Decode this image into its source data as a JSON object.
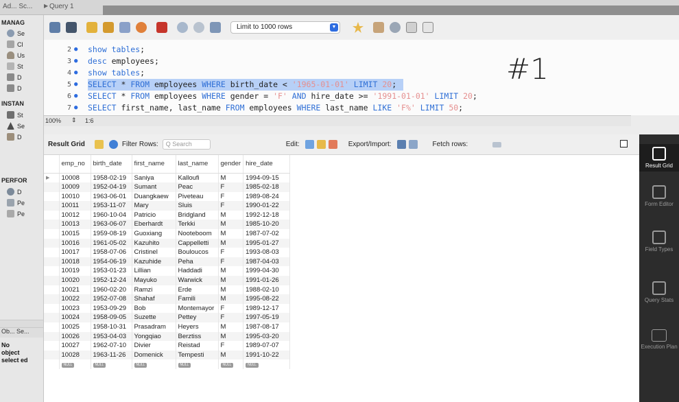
{
  "top_tabs": [
    "Ad... Sc...",
    "Query 1"
  ],
  "navigator": {
    "management_header": "MANAG",
    "management_items": [
      "Se",
      "Cl",
      "Us",
      "St",
      "D",
      "D"
    ],
    "instance_header": "INSTAN",
    "instance_items": [
      "St",
      "Se",
      "D"
    ],
    "performance_header": "PERFOR",
    "performance_items": [
      "D",
      "Pe",
      "Pe"
    ],
    "object_info_tab": "Ob... Se...",
    "no_object": "No object select ed"
  },
  "toolbar": {
    "limit_select": "Limit to 1000 rows"
  },
  "editor": {
    "annotation": "#1",
    "lines": [
      {
        "num": "2",
        "tokens": [
          {
            "t": "show tables",
            "c": "kw"
          },
          {
            "t": ";",
            "c": ""
          }
        ]
      },
      {
        "num": "3",
        "tokens": [
          {
            "t": "desc",
            "c": "kw"
          },
          {
            "t": " employees;",
            "c": ""
          }
        ]
      },
      {
        "num": "4",
        "tokens": [
          {
            "t": "show tables",
            "c": "kw"
          },
          {
            "t": ";",
            "c": ""
          }
        ]
      },
      {
        "num": "5",
        "highlight": true,
        "tokens": [
          {
            "t": "SELECT",
            "c": "kw"
          },
          {
            "t": " * ",
            "c": ""
          },
          {
            "t": "FROM",
            "c": "kw"
          },
          {
            "t": " employees ",
            "c": ""
          },
          {
            "t": "WHERE",
            "c": "kw"
          },
          {
            "t": " birth_date < ",
            "c": ""
          },
          {
            "t": "'1965-01-01'",
            "c": "str"
          },
          {
            "t": " ",
            "c": ""
          },
          {
            "t": "LIMIT",
            "c": "kw"
          },
          {
            "t": " ",
            "c": ""
          },
          {
            "t": "20",
            "c": "num2"
          },
          {
            "t": ";",
            "c": ""
          }
        ]
      },
      {
        "num": "6",
        "tokens": [
          {
            "t": "SELECT",
            "c": "kw"
          },
          {
            "t": " * ",
            "c": ""
          },
          {
            "t": "FROM",
            "c": "kw"
          },
          {
            "t": " employees ",
            "c": ""
          },
          {
            "t": "WHERE",
            "c": "kw"
          },
          {
            "t": " gender = ",
            "c": ""
          },
          {
            "t": "'F'",
            "c": "str"
          },
          {
            "t": " ",
            "c": ""
          },
          {
            "t": "AND",
            "c": "kw"
          },
          {
            "t": " hire_date >= ",
            "c": ""
          },
          {
            "t": "'1991-01-01'",
            "c": "str"
          },
          {
            "t": " ",
            "c": ""
          },
          {
            "t": "LIMIT",
            "c": "kw"
          },
          {
            "t": " ",
            "c": ""
          },
          {
            "t": "20",
            "c": "num2"
          },
          {
            "t": ";",
            "c": ""
          }
        ]
      },
      {
        "num": "7",
        "tokens": [
          {
            "t": "SELECT",
            "c": "kw"
          },
          {
            "t": " first_name, last_name ",
            "c": ""
          },
          {
            "t": "FROM",
            "c": "kw"
          },
          {
            "t": " employees ",
            "c": ""
          },
          {
            "t": "WHERE",
            "c": "kw"
          },
          {
            "t": " last_name ",
            "c": ""
          },
          {
            "t": "LIKE",
            "c": "kw"
          },
          {
            "t": " ",
            "c": ""
          },
          {
            "t": "'F%'",
            "c": "str"
          },
          {
            "t": " ",
            "c": ""
          },
          {
            "t": "LIMIT",
            "c": "kw"
          },
          {
            "t": " ",
            "c": ""
          },
          {
            "t": "50",
            "c": "num2"
          },
          {
            "t": ";",
            "c": ""
          }
        ]
      }
    ],
    "status_zoom": "100%",
    "status_position": "1:6"
  },
  "result": {
    "result_grid_label": "Result Grid",
    "filter_rows_label": "Filter Rows:",
    "search_placeholder": "Q Search",
    "edit_label": "Edit:",
    "export_label": "Export/Import:",
    "fetch_label": "Fetch rows:",
    "columns": [
      "emp_no",
      "birth_date",
      "first_name",
      "last_name",
      "gender",
      "hire_date"
    ],
    "rows": [
      [
        "10008",
        "1958-02-19",
        "Saniya",
        "Kalloufi",
        "M",
        "1994-09-15"
      ],
      [
        "10009",
        "1952-04-19",
        "Sumant",
        "Peac",
        "F",
        "1985-02-18"
      ],
      [
        "10010",
        "1963-06-01",
        "Duangkaew",
        "Piveteau",
        "F",
        "1989-08-24"
      ],
      [
        "10011",
        "1953-11-07",
        "Mary",
        "Sluis",
        "F",
        "1990-01-22"
      ],
      [
        "10012",
        "1960-10-04",
        "Patricio",
        "Bridgland",
        "M",
        "1992-12-18"
      ],
      [
        "10013",
        "1963-06-07",
        "Eberhardt",
        "Terkki",
        "M",
        "1985-10-20"
      ],
      [
        "10015",
        "1959-08-19",
        "Guoxiang",
        "Nooteboom",
        "M",
        "1987-07-02"
      ],
      [
        "10016",
        "1961-05-02",
        "Kazuhito",
        "Cappelletti",
        "M",
        "1995-01-27"
      ],
      [
        "10017",
        "1958-07-06",
        "Cristinel",
        "Bouloucos",
        "F",
        "1993-08-03"
      ],
      [
        "10018",
        "1954-06-19",
        "Kazuhide",
        "Peha",
        "F",
        "1987-04-03"
      ],
      [
        "10019",
        "1953-01-23",
        "Lillian",
        "Haddadi",
        "M",
        "1999-04-30"
      ],
      [
        "10020",
        "1952-12-24",
        "Mayuko",
        "Warwick",
        "M",
        "1991-01-26"
      ],
      [
        "10021",
        "1960-02-20",
        "Ramzi",
        "Erde",
        "M",
        "1988-02-10"
      ],
      [
        "10022",
        "1952-07-08",
        "Shahaf",
        "Famili",
        "M",
        "1995-08-22"
      ],
      [
        "10023",
        "1953-09-29",
        "Bob",
        "Montemayor",
        "F",
        "1989-12-17"
      ],
      [
        "10024",
        "1958-09-05",
        "Suzette",
        "Pettey",
        "F",
        "1997-05-19"
      ],
      [
        "10025",
        "1958-10-31",
        "Prasadram",
        "Heyers",
        "M",
        "1987-08-17"
      ],
      [
        "10026",
        "1953-04-03",
        "Yongqiao",
        "Berztiss",
        "M",
        "1995-03-20"
      ],
      [
        "10027",
        "1962-07-10",
        "Divier",
        "Reistad",
        "F",
        "1989-07-07"
      ],
      [
        "10028",
        "1963-11-26",
        "Domenick",
        "Tempesti",
        "M",
        "1991-10-22"
      ]
    ],
    "null_label": "NULL"
  },
  "side_panel": {
    "buttons": [
      {
        "label": "Result Grid",
        "active": true
      },
      {
        "label": "Form Editor",
        "active": false
      },
      {
        "label": "Field Types",
        "active": false
      },
      {
        "label": "Query Stats",
        "active": false
      },
      {
        "label": "Execution Plan",
        "active": false
      }
    ]
  },
  "colors": {
    "keyword": "#2f6fd6",
    "string": "#e58f8f",
    "selection": "#b7d0f7",
    "side_panel_bg": "#2c2c2c"
  }
}
